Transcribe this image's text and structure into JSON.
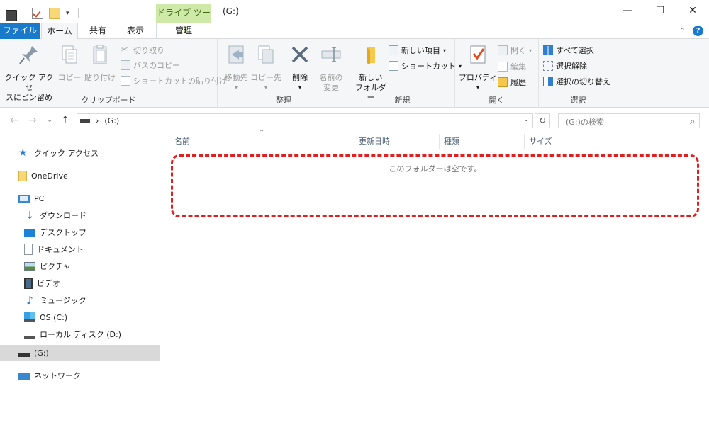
{
  "titlebar": {
    "title": "(G:)",
    "context_tab": "ドライブ ツール",
    "minimize": "—",
    "maximize": "☐",
    "close": "✕",
    "qat_dropdown": "▾"
  },
  "tabs": {
    "file": "ファイル",
    "home": "ホーム",
    "share": "共有",
    "view": "表示",
    "manage": "管理",
    "collapse": "⌃",
    "help": "?"
  },
  "ribbon": {
    "clipboard": {
      "label": "クリップボード",
      "pin_line1": "クイック アクセ",
      "pin_line2": "スにピン留め",
      "copy": "コピー",
      "paste": "貼り付け",
      "cut": "切り取り",
      "copy_path": "パスのコピー",
      "paste_shortcut": "ショートカットの貼り付け"
    },
    "organize": {
      "label": "整理",
      "move_to": "移動先",
      "copy_to": "コピー先",
      "delete": "削除",
      "rename_line1": "名前の",
      "rename_line2": "変更"
    },
    "new": {
      "label": "新規",
      "new_folder_line1": "新しい",
      "new_folder_line2": "フォルダー",
      "new_item": "新しい項目",
      "shortcut": "ショートカット"
    },
    "open": {
      "label": "開く",
      "properties": "プロパティ",
      "open": "開く",
      "edit": "編集",
      "history": "履歴"
    },
    "select": {
      "label": "選択",
      "select_all": "すべて選択",
      "select_none": "選択解除",
      "invert": "選択の切り替え"
    }
  },
  "navbar": {
    "back": "←",
    "forward": "→",
    "recent": "⌄",
    "up": "↑",
    "breadcrumb_sep": "›",
    "address": "(G:)",
    "refresh": "↻",
    "search_placeholder": "(G:)の検索",
    "search_icon": "⌕"
  },
  "navpane": {
    "quick_access": "クイック アクセス",
    "onedrive": "OneDrive",
    "pc": "PC",
    "downloads": "ダウンロード",
    "desktop": "デスクトップ",
    "documents": "ドキュメント",
    "pictures": "ピクチャ",
    "videos": "ビデオ",
    "music": "ミュージック",
    "os_c": "OS (C:)",
    "local_d": "ローカル ディスク (D:)",
    "drive_g": "(G:)",
    "network": "ネットワーク"
  },
  "content": {
    "columns": [
      "名前",
      "更新日時",
      "種類",
      "サイズ"
    ],
    "empty_message": "このフォルダーは空です。"
  }
}
